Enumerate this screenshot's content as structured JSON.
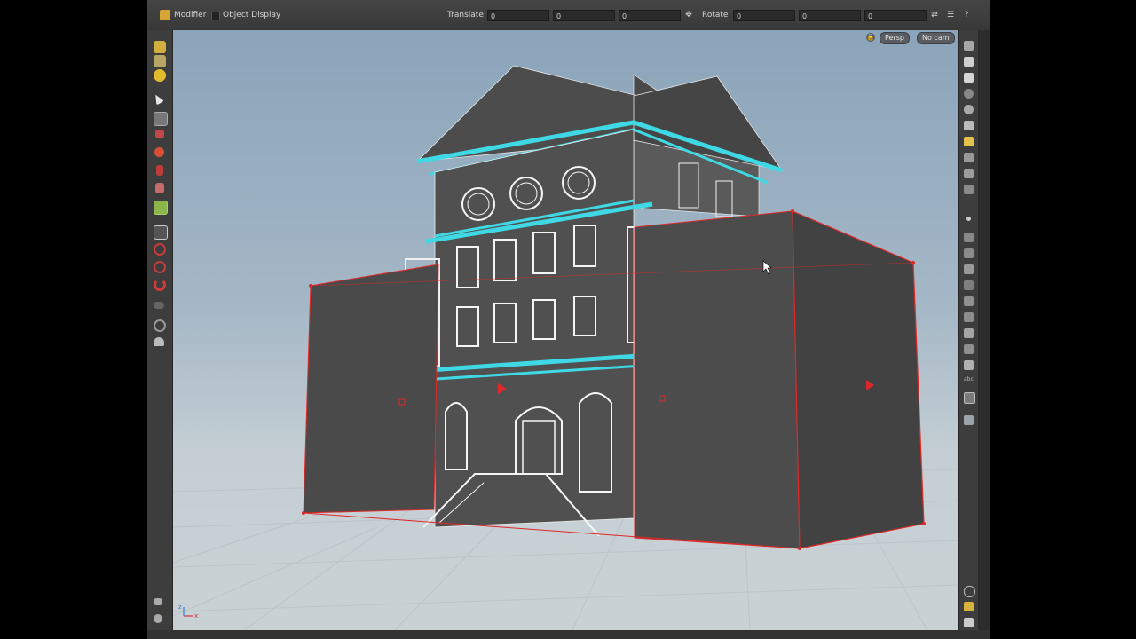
{
  "toolbar": {
    "modifier_label": "Modifier",
    "object_display_label": "Object Display",
    "translate_label": "Translate",
    "translate_values": [
      "0",
      "0",
      "0"
    ],
    "rotate_label": "Rotate",
    "rotate_values": [
      "0",
      "0",
      "0"
    ]
  },
  "viewport": {
    "view_label": "Persp",
    "camera_label": "No cam",
    "axis_labels": {
      "z": "z",
      "x": "x"
    }
  },
  "colors": {
    "selection_red": "#e02828",
    "highlight_cyan": "#3fd9e6",
    "sky_top": "#8ba4ba",
    "ground": "#c8d0d4"
  },
  "icons": {
    "left_toolbar": [
      "create-icon",
      "select-geo-icon",
      "paint-icon",
      "select-arrow-icon",
      "lock-icon",
      "brush-icon",
      "sphere-icon",
      "tool-icon",
      "pose-icon",
      "view-icon",
      "handle-icon",
      "snap-icon",
      "lasso-icon",
      "magnet-icon",
      "display-icon",
      "camera-icon"
    ],
    "right_toolbar": [
      "camera-view-icon",
      "lock-icon",
      "light-icon",
      "ghost-icon",
      "display-options-icon",
      "grid-icon",
      "wire-icon",
      "point-icon",
      "normal-icon",
      "info-icon",
      "snapshot-icon"
    ]
  }
}
